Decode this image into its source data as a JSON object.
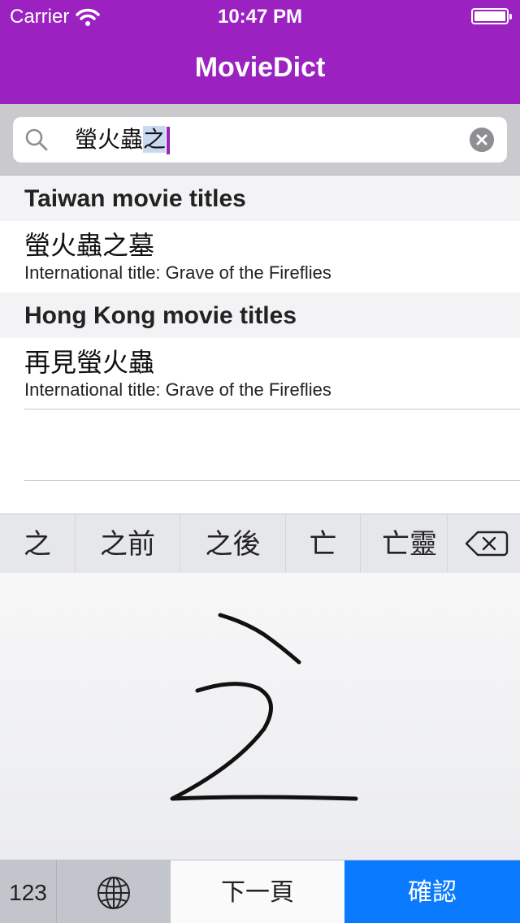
{
  "status_bar": {
    "carrier": "Carrier",
    "time": "10:47 PM"
  },
  "nav": {
    "title": "MovieDict",
    "background": "#9b22c0"
  },
  "search": {
    "text_committed": "螢火蟲",
    "text_marked": "之",
    "icons": [
      "search-icon",
      "clear-icon"
    ]
  },
  "sections": [
    {
      "header": "Taiwan movie titles",
      "rows": [
        {
          "title": "螢火蟲之墓",
          "subtitle": "International title: Grave of the Fireflies"
        }
      ]
    },
    {
      "header": "Hong Kong movie titles",
      "rows": [
        {
          "title": "再見螢火蟲",
          "subtitle": "International title: Grave of the Fireflies"
        }
      ]
    }
  ],
  "keyboard": {
    "candidates": [
      "之",
      "之前",
      "之後",
      "亡",
      "亡靈"
    ],
    "icons": [
      "delete-icon",
      "globe-icon"
    ],
    "keys": {
      "numbers": "123",
      "next_page": "下一頁",
      "confirm": "確認"
    },
    "confirm_color": "#0a7aff"
  }
}
